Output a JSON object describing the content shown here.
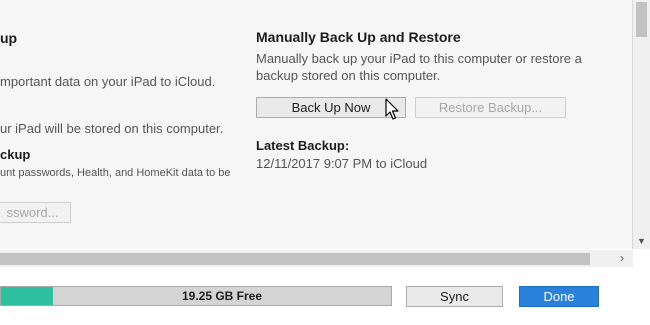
{
  "left_column": {
    "heading_partial": "up",
    "line1": "mportant data on your iPad to iCloud.",
    "line2": "ur iPad will be stored on this computer.",
    "encrypt_heading_partial": "ckup",
    "encrypt_desc": "unt passwords, Health, and HomeKit data to be",
    "password_button": "ssword..."
  },
  "right_column": {
    "heading": "Manually Back Up and Restore",
    "desc_line1": "Manually back up your iPad to this computer or restore a",
    "desc_line2": "backup stored on this computer.",
    "back_up_now": "Back Up Now",
    "restore_backup": "Restore Backup...",
    "latest_heading": "Latest Backup:",
    "latest_value": "12/11/2017 9:07 PM to iCloud"
  },
  "footer": {
    "storage_label": "19.25 GB Free",
    "storage_used_fraction": 0.13,
    "sync_label": "Sync",
    "done_label": "Done"
  },
  "colors": {
    "storage_used": "#2ec0a1",
    "primary": "#2a82da"
  }
}
